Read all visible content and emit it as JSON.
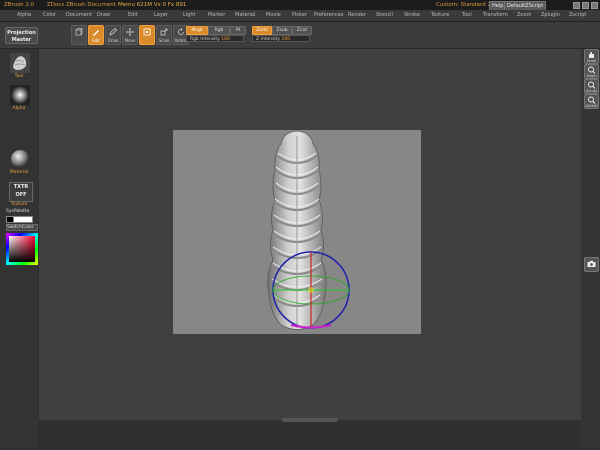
{
  "titlebar": {
    "app": "ZBrush 2.0",
    "document": "ZDocs ZBrush Document",
    "memory": "Memu 621M  Vx 0  Fx 891",
    "custom_label": "Custom: Standard 2.0",
    "help_label": "Help",
    "script_label": "DefaultZScript"
  },
  "menu": {
    "items": [
      "Alpha",
      "Color",
      "Document",
      "Draw",
      "Edit",
      "Layer",
      "Light",
      "Marker",
      "Material",
      "Movie",
      "Picker",
      "Preferences",
      "Render",
      "Stencil",
      "Stroke",
      "Texture",
      "Tool",
      "Transform",
      "Zoom",
      "Zplugin",
      "Zscript"
    ]
  },
  "toolbar": {
    "projection_master": "Projection Master",
    "buttons": [
      "Edit",
      "Draw",
      "Move",
      "Scale",
      "Rotate"
    ],
    "mrgb": "Mrgb",
    "rgb": "Rgb",
    "m": "M",
    "zadd": "Zadd",
    "zsub": "Zsub",
    "zcut": "Zcut",
    "rgb_intensity_label": "Rgb Intensity",
    "rgb_intensity_value": "100",
    "z_intensity_label": "Z Intensity",
    "z_intensity_value": "100"
  },
  "leftpanel": {
    "tool_label": "Tool",
    "alpha_label": "Alpha",
    "material_label": "Material",
    "texture_label": "Texture",
    "txtr_line1": "TXTR",
    "txtr_line2": "OFF",
    "sys_palette": "SysPalette",
    "switch_color": "SwitchColor"
  },
  "rightpanel": {
    "buttons": [
      "Scroll",
      "Zoom",
      "Actual",
      "AAHalf"
    ]
  },
  "colors": {
    "accent": "#d98a2b",
    "title_text": "#d89b3a",
    "canvas_bg": "#878787"
  }
}
